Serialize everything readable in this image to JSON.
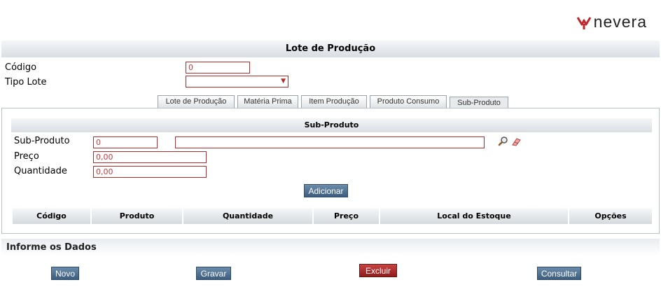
{
  "brand": {
    "name": "nevera"
  },
  "page": {
    "title": "Lote de Produção"
  },
  "form": {
    "codigo_label": "Código",
    "codigo_value": "0",
    "tipo_lote_label": "Tipo Lote",
    "tipo_lote_value": ""
  },
  "tabs": [
    {
      "label": "Lote de Produção",
      "active": false
    },
    {
      "label": "Matéria Prima",
      "active": false
    },
    {
      "label": "Item Produção",
      "active": false
    },
    {
      "label": "Produto Consumo",
      "active": false
    },
    {
      "label": "Sub-Produto",
      "active": true
    }
  ],
  "subproduto": {
    "section_title": "Sub-Produto",
    "sub_produto_label": "Sub-Produto",
    "sub_produto_code": "0",
    "sub_produto_desc": "",
    "preco_label": "Preço",
    "preco_value": "0,00",
    "quantidade_label": "Quantidade",
    "quantidade_value": "0,00",
    "add_button": "Adicionar",
    "search_icon": "magnifier-icon",
    "clear_icon": "eraser-icon"
  },
  "table": {
    "columns": [
      "Código",
      "Produto",
      "Quantidade",
      "Preço",
      "Local do Estoque",
      "Opções"
    ],
    "rows": []
  },
  "footer": {
    "title": "Informe os Dados",
    "buttons": {
      "novo": "Novo",
      "gravar": "Gravar",
      "excluir": "Excluir",
      "consultar": "Consultar"
    }
  },
  "colors": {
    "field_border": "#b52a2a",
    "button_blue": "#3d5d7e",
    "button_red": "#8e1c1c",
    "brand_red": "#c0272d"
  }
}
